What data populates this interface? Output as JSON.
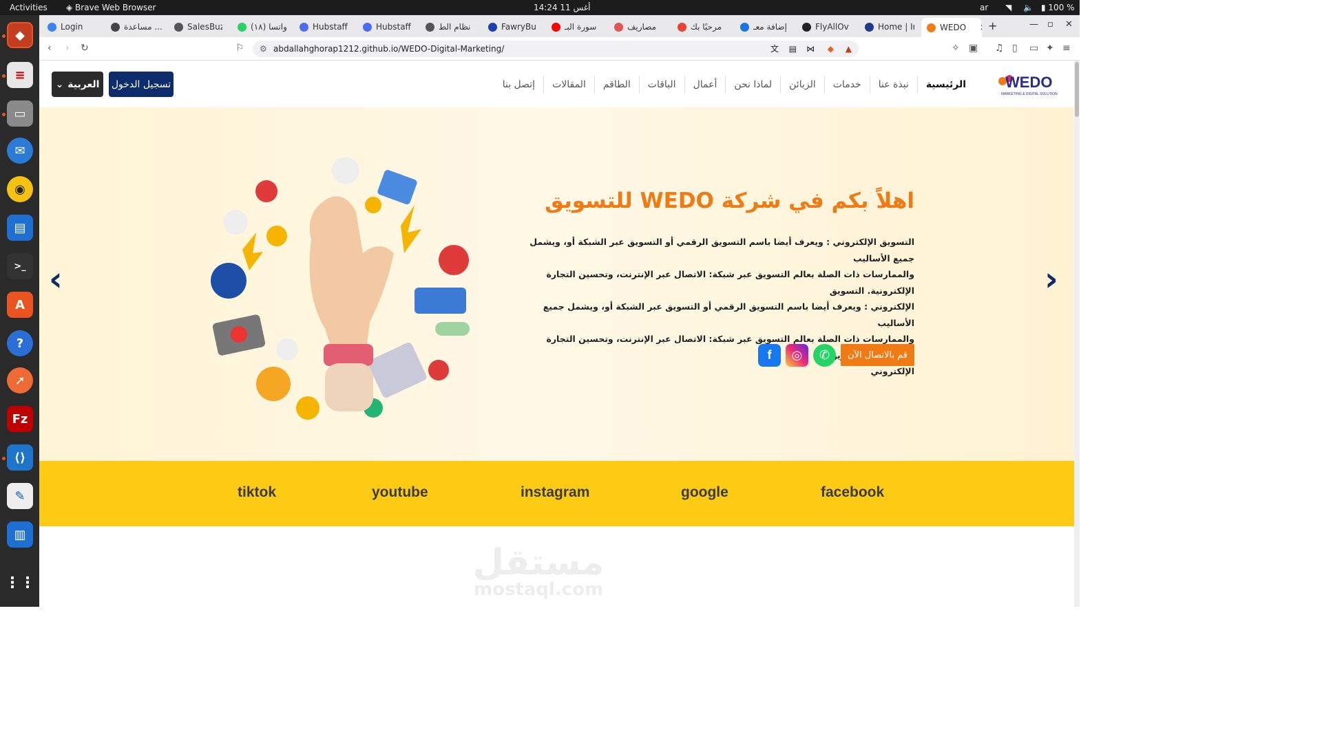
{
  "os": {
    "activities": "Activities",
    "active_app": "Brave Web Browser",
    "clock": "أغس 11  14:24",
    "lang": "ar",
    "battery": "100 %"
  },
  "tabs": [
    {
      "label": "Login",
      "color": "#3b82f6"
    },
    {
      "label": "مساعدة ...",
      "color": "#444"
    },
    {
      "label": "SalesBuz",
      "color": "#555"
    },
    {
      "label": "(١٨) واتسا",
      "color": "#25d366"
    },
    {
      "label": "Hubstaff",
      "color": "#4a6cf7"
    },
    {
      "label": "Hubstaff",
      "color": "#4a6cf7"
    },
    {
      "label": "نظام الط",
      "color": "#555"
    },
    {
      "label": "FawryBu",
      "color": "#1e40af"
    },
    {
      "label": "سورة البـ",
      "color": "#ff0000"
    },
    {
      "label": "مصاريف",
      "color": "#e25555"
    },
    {
      "label": "مرحبًا بك",
      "color": "#ea4335"
    },
    {
      "label": "إضافة معـ",
      "color": "#1a73e8"
    },
    {
      "label": "FlyAllOv",
      "color": "#222"
    },
    {
      "label": "Home | In",
      "color": "#1e3a8a"
    },
    {
      "label": "WEDO",
      "color": "#f07b14"
    }
  ],
  "address_bar": {
    "url": "abdallahghorap1212.github.io/WEDO-Digital-Marketing/"
  },
  "nav": {
    "language_button": "العربية",
    "login_button": "تسجيل الدخول",
    "menu": [
      "الرئيسية",
      "نبذة عنا",
      "خدمات",
      "الزبائن",
      "لماذا نحن",
      "أعمال",
      "الباقات",
      "الطاقم",
      "المقالات",
      "إتصل بنا"
    ],
    "logo_text": "WEDO",
    "logo_tagline": "MARKETING & DIGITAL SOLUTION"
  },
  "hero": {
    "title": "اهلاً بكم في شركة WEDO للتسويق",
    "lines": [
      "التسويق الإلكتروني : ويعرف أيضا باسم التسويق الرقمي أو التسويق عبر الشبكة أو، ويشمل جميع الأساليب",
      "والممارسات ذات الصلة بعالم التسويق عبر شبكة: الاتصال عبر الإنترنت، وتحسين التجارة الإلكترونية. التسويق",
      "الإلكتروني : ويعرف أيضا باسم التسويق الرقمي أو التسويق عبر الشبكة أو، ويشمل جميع الأساليب",
      "والممارسات ذات الصلة بعالم التسويق عبر شبكة: الاتصال عبر الإنترنت، وتحسين التجارة الإلكترونية. التسويق",
      "الإلكتروني"
    ],
    "contact_button": "قم بالاتصال الآن",
    "social": [
      {
        "name": "whatsapp-icon",
        "color": "#25d366"
      },
      {
        "name": "instagram-icon",
        "color": "#d62976"
      },
      {
        "name": "facebook-icon",
        "color": "#1877f2"
      }
    ],
    "prev_arrow": "‹",
    "next_arrow": "›"
  },
  "brands": [
    "tiktok",
    "youtube",
    "instagram",
    "google",
    "facebook"
  ],
  "watermark": {
    "ar": "مستقل",
    "en": "mostaql.com"
  }
}
